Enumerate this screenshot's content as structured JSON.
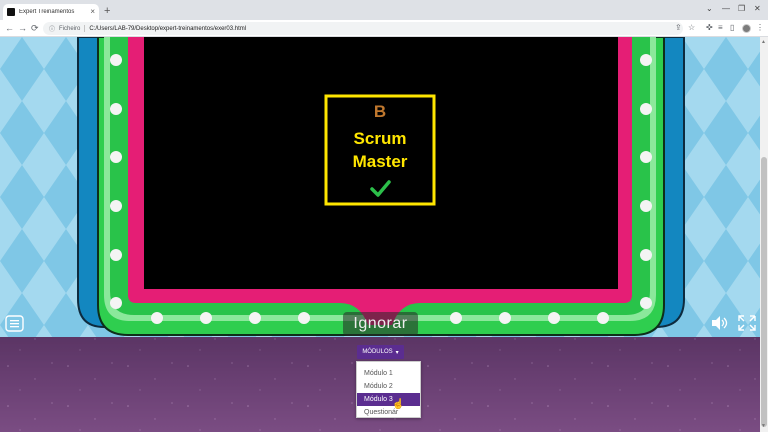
{
  "browser": {
    "tab_title": "Expert Treinamentos",
    "tab_close": "×",
    "new_tab": "+",
    "back": "←",
    "forward": "→",
    "reload": "⟳",
    "address_scheme": "Ficheiro",
    "address_url": "C:/Users/LAB-79/Desktop/expert-treinamentos/exer03.html",
    "info_icon": "info-icon",
    "window_controls": [
      "⌄",
      "—",
      "❐",
      "✕"
    ]
  },
  "game": {
    "card": {
      "letter": "B",
      "answer_line1": "Scrum",
      "answer_line2": "Master",
      "check": "✔"
    },
    "ignore_label": "Ignorar",
    "menu_icon": "hamburger-icon",
    "volume_icon": "speaker-icon",
    "fullscreen_icon": "fullscreen-icon"
  },
  "dropdown": {
    "label": "MÓDULOS",
    "caret": "▾",
    "items": [
      {
        "label": "Módulo 1"
      },
      {
        "label": "Módulo 2"
      },
      {
        "label": "Módulo 3"
      },
      {
        "label": "Questionár"
      }
    ],
    "selected_index": 2
  },
  "colors": {
    "sky": "#9fd6ee",
    "diamond": "#7ec7e6",
    "frame_blue": "#1387c0",
    "frame_green": "#2fce4f",
    "frame_light_green": "#8be89b",
    "frame_pink": "#e51e75",
    "screen": "#000000",
    "card_border": "#ffe600",
    "answer_text": "#ffe600",
    "letter": "#c0782e",
    "check": "#2cbf4a",
    "floor": "#6b3f73",
    "dropdown_accent": "#5b2d90"
  }
}
